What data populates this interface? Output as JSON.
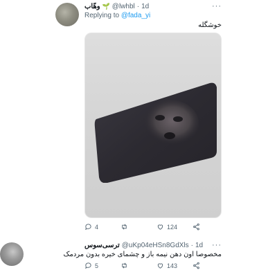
{
  "tweet1": {
    "display_name": "وهّاب",
    "badge_icon": "leaf-icon",
    "handle": "@lwhbl",
    "separator": "·",
    "time": "1d",
    "more_label": "···",
    "replying_label": "Replying to",
    "replying_handle": "@fada_yi",
    "text": "خوشگله",
    "actions": {
      "reply_count": "4",
      "retweet_count": "",
      "like_count": "124",
      "share_count": ""
    }
  },
  "tweet2": {
    "display_name": "ترسی‌سوس",
    "handle": "@uKp04eHSn8GdXls",
    "separator": "·",
    "time": "1d",
    "more_label": "···",
    "text": "مخصوصا اون دهن نیمه باز و چشمای خیره بدون مردمک",
    "actions": {
      "reply_count": "5",
      "retweet_count": "",
      "like_count": "143",
      "share_count": ""
    }
  },
  "colors": {
    "link": "#1d9bf0",
    "muted": "#536471",
    "text": "#0f1419",
    "verified_leaf": "#2e9b3a"
  }
}
